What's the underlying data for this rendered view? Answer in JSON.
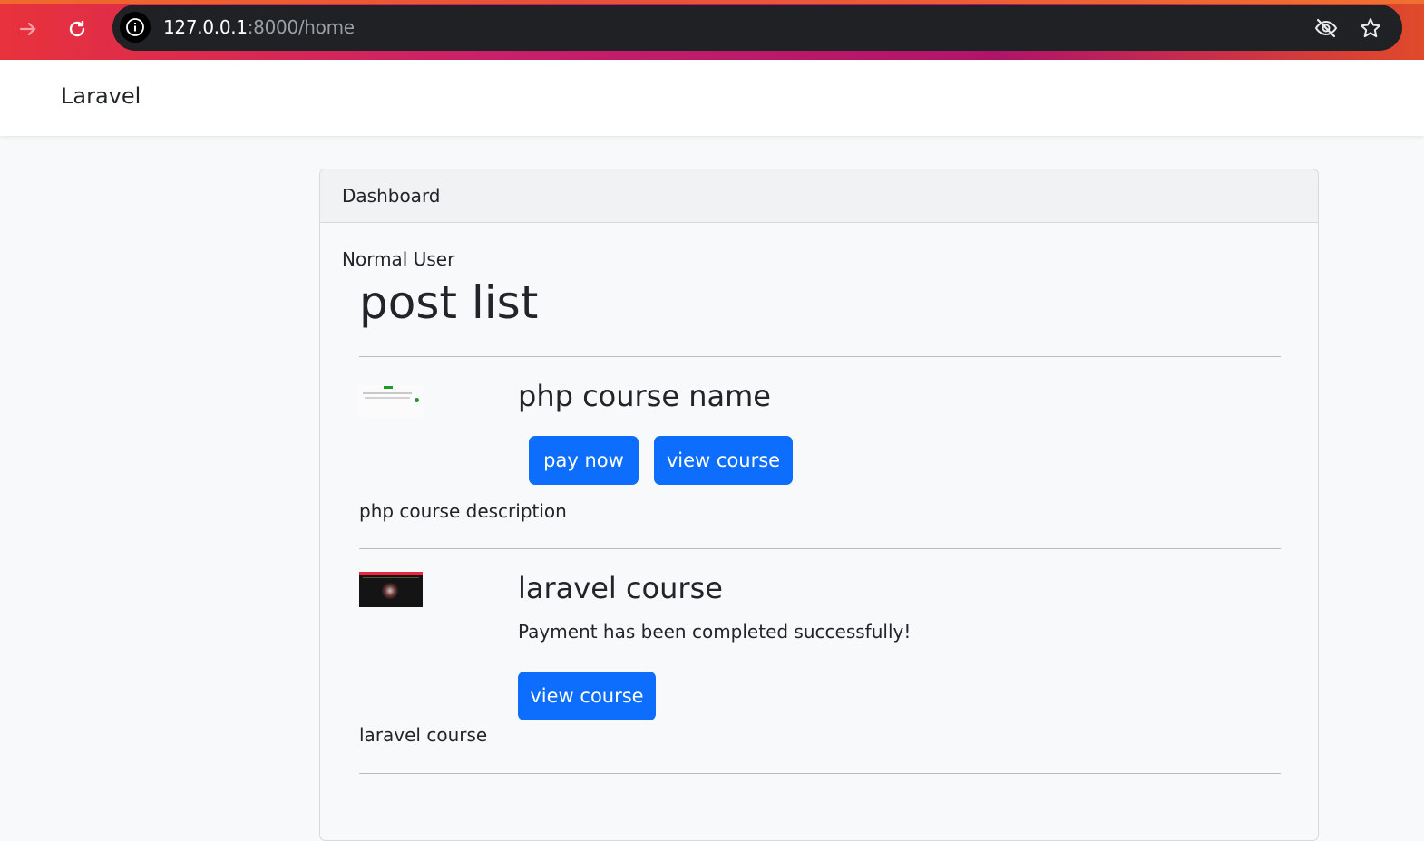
{
  "browser": {
    "url_host": "127.0.0.1",
    "url_rest": ":8000/home"
  },
  "navbar": {
    "brand": "Laravel"
  },
  "card": {
    "header": "Dashboard",
    "role": "Normal User",
    "heading": "post list"
  },
  "posts": [
    {
      "title": "php course name",
      "pay_label": "pay now",
      "view_label": "view course",
      "description": "php course description"
    },
    {
      "title": "laravel course",
      "status": "Payment has been completed successfully!",
      "view_label": "view course",
      "description": "laravel course"
    }
  ],
  "colors": {
    "primary": "#0d6efd",
    "omnibox": "#202124"
  }
}
